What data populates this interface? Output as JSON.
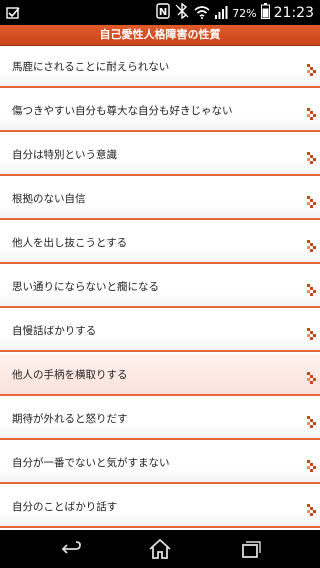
{
  "status_bar": {
    "left_icon": "checkbox-notification-icon",
    "battery_percent": "72%",
    "time": "21:23"
  },
  "title": "自己愛性人格障害の性質",
  "items": [
    {
      "label": "馬鹿にされることに耐えられない"
    },
    {
      "label": "傷つきやすい自分も尊大な自分も好きじゃない"
    },
    {
      "label": "自分は特別という意識"
    },
    {
      "label": "根拠のない自信"
    },
    {
      "label": "他人を出し抜こうとする"
    },
    {
      "label": "思い通りにならないと癇になる"
    },
    {
      "label": "自慢話ばかりする"
    },
    {
      "label": "他人の手柄を横取りする",
      "highlighted": true
    },
    {
      "label": "期待が外れると怒りだす"
    },
    {
      "label": "自分が一番でないと気がすまない"
    },
    {
      "label": "自分のことばかり話す"
    }
  ],
  "colors": {
    "accent": "#d9522a",
    "row_divider": "#e2673a",
    "highlight_row": "#fbe1da"
  }
}
